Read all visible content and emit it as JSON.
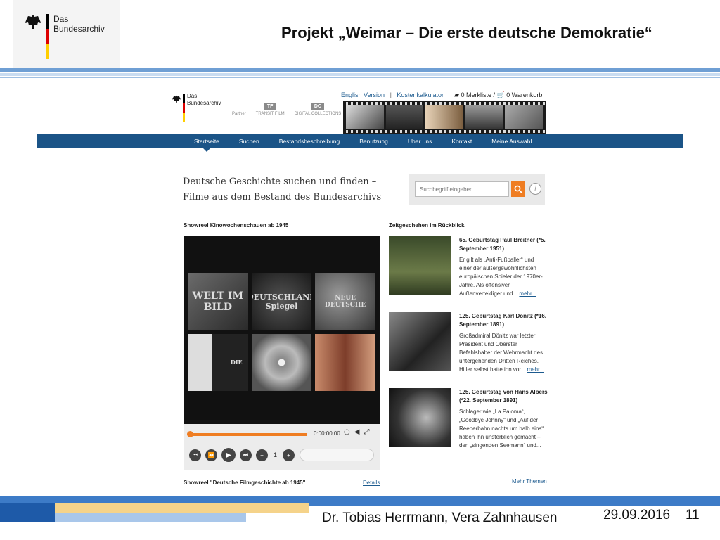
{
  "slide": {
    "logo_line1": "Das",
    "logo_line2": "Bundesarchiv",
    "title": "Projekt „Weimar – Die erste deutsche Demokratie“",
    "footer_author": "Dr. Tobias Herrmann, Vera Zahnhausen",
    "footer_date": "29.09.2016",
    "footer_page": "11"
  },
  "site": {
    "logo_line1": "Das",
    "logo_line2": "Bundesarchiv",
    "partner_label": "Partner",
    "partner1_mark": "TF",
    "partner1_name": "TRANSIT FILM",
    "partner2_mark": "DC",
    "partner2_name": "DIGITAL COLLECTIONS",
    "topnav": {
      "english": "English Version",
      "sep": "|",
      "kosten": "Kostenkalkulator"
    },
    "merkliste": "0 Merkliste",
    "cart_sep": "/",
    "warenkorb": "0 Warenkorb",
    "nav": [
      "Startseite",
      "Suchen",
      "Bestandsbeschreibung",
      "Benutzung",
      "Über uns",
      "Kontakt",
      "Meine Auswahl"
    ],
    "headline_line1": "Deutsche Geschichte suchen und finden –",
    "headline_line2": "Filme aus dem Bestand des Bundesarchivs",
    "search_placeholder": "Suchbegriff eingeben...",
    "info_label": "i",
    "showreel1_title": "Showreel Kinowochenschauen ab 1945",
    "tiles": [
      "WELT IM BILD",
      "DEUTSCHLAND Spiegel",
      "NEUE DEUTSCHE",
      "DIE",
      "",
      ""
    ],
    "timecode": "0:00:00.00",
    "page_number": "1",
    "zeit_title": "Zeitgeschehen im Rückblick",
    "news": [
      {
        "title": "65. Geburtstag Paul Breitner (*5. September 1951)",
        "text": "Er gilt als „Anti-Fußballer“ und einer der außergewöhnlichsten europäischen Spieler der 1970er-Jahre. Als offensiver Außenverteidiger und...",
        "more": "mehr..."
      },
      {
        "title": "125. Geburtstag Karl Dönitz (*16. September 1891)",
        "text": "Großadmiral Dönitz war letzter Präsident und Oberster Befehlshaber der Wehrmacht des untergehenden Dritten Reiches. Hitler selbst hatte ihn vor...",
        "more": "mehr..."
      },
      {
        "title": "125. Geburtstag von Hans Albers (*22. September 1891)",
        "text": "Schlager wie „La Paloma“, „Goodbye Johnny“ und „Auf der Reeperbahn nachts um halb eins“ haben ihn unsterblich gemacht – den „singenden Seemann“ und...",
        "more": ""
      }
    ],
    "showreel2_title": "Showreel \"Deutsche Filmgeschichte ab 1945\"",
    "details_link": "Details",
    "more_themes_link": "Mehr Themen"
  },
  "colors": {
    "nav_blue": "#1b5487",
    "accent_orange": "#ef7d22",
    "flag_black": "#000000",
    "flag_red": "#dd0000",
    "flag_gold": "#ffce00"
  }
}
